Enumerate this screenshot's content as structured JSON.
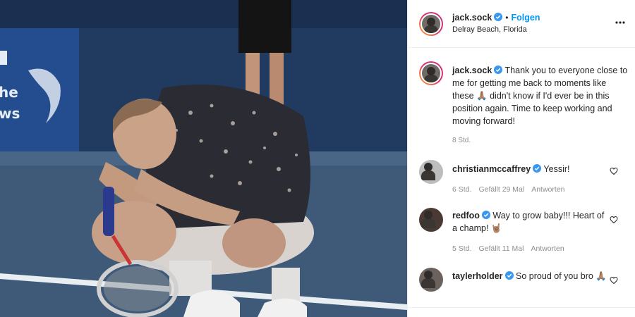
{
  "post": {
    "author": "jack.sock",
    "follow_label": "Folgen",
    "location": "Delray Beach, Florida",
    "caption_text": "Thank you to everyone close to me for getting me back to moments like these 🙏🏽 didn't know if I'd ever be in this position again. Time to keep working and moving forward!",
    "caption_time": "8 Std."
  },
  "comments": [
    {
      "user": "christianmccaffrey",
      "text": "Yessir!",
      "time": "6 Std.",
      "likes": "Gefällt 29 Mal",
      "reply": "Antworten"
    },
    {
      "user": "redfoo",
      "text": "Way to grow baby!!! Heart of a champ! 🤘🏽",
      "time": "5 Std.",
      "likes": "Gefällt 11 Mal",
      "reply": "Antworten"
    },
    {
      "user": "taylerholder",
      "text": "So proud of you bro 🙏🏽",
      "time": "",
      "likes": "",
      "reply": ""
    }
  ],
  "icons": {
    "verified": "verified-badge-icon",
    "more": "more-options-icon",
    "heart": "heart-icon"
  },
  "colors": {
    "link": "#0095f6",
    "verified": "#3897f0",
    "text": "#262626",
    "muted": "#8e8e8e"
  }
}
